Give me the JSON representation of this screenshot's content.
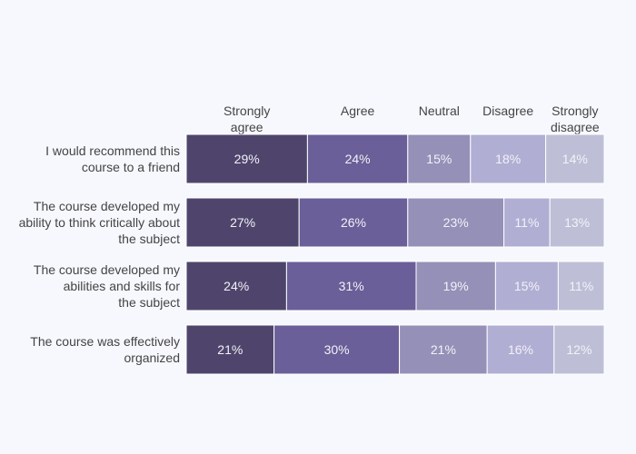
{
  "chart_data": {
    "type": "bar",
    "orientation": "horizontal",
    "stacked": true,
    "title": "",
    "xlabel": "",
    "ylabel": "",
    "xlim": [
      0,
      100
    ],
    "grid": false,
    "legend_position": "top",
    "categories": [
      [
        "I would recommend this",
        "course to a friend"
      ],
      [
        "The course developed my",
        "ability to think critically about",
        "the subject"
      ],
      [
        "The course developed my",
        "abilities and skills for",
        "the subject"
      ],
      [
        "The course was effectively",
        "organized"
      ]
    ],
    "series": [
      {
        "name": "Strongly agree",
        "legend_lines": [
          "Strongly",
          "agree"
        ],
        "color": "#4f456c",
        "values": [
          29,
          27,
          24,
          21
        ]
      },
      {
        "name": "Agree",
        "legend_lines": [
          "Agree"
        ],
        "color": "#6a5f98",
        "values": [
          24,
          26,
          31,
          30
        ]
      },
      {
        "name": "Neutral",
        "legend_lines": [
          "Neutral"
        ],
        "color": "#9490b7",
        "values": [
          15,
          23,
          19,
          21
        ]
      },
      {
        "name": "Disagree",
        "legend_lines": [
          "Disagree"
        ],
        "color": "#b1aed3",
        "values": [
          18,
          11,
          15,
          16
        ]
      },
      {
        "name": "Strongly disagree",
        "legend_lines": [
          "Strongly",
          "disagree"
        ],
        "color": "#bebfd6",
        "values": [
          14,
          13,
          11,
          12
        ]
      }
    ],
    "value_suffix": "%"
  }
}
